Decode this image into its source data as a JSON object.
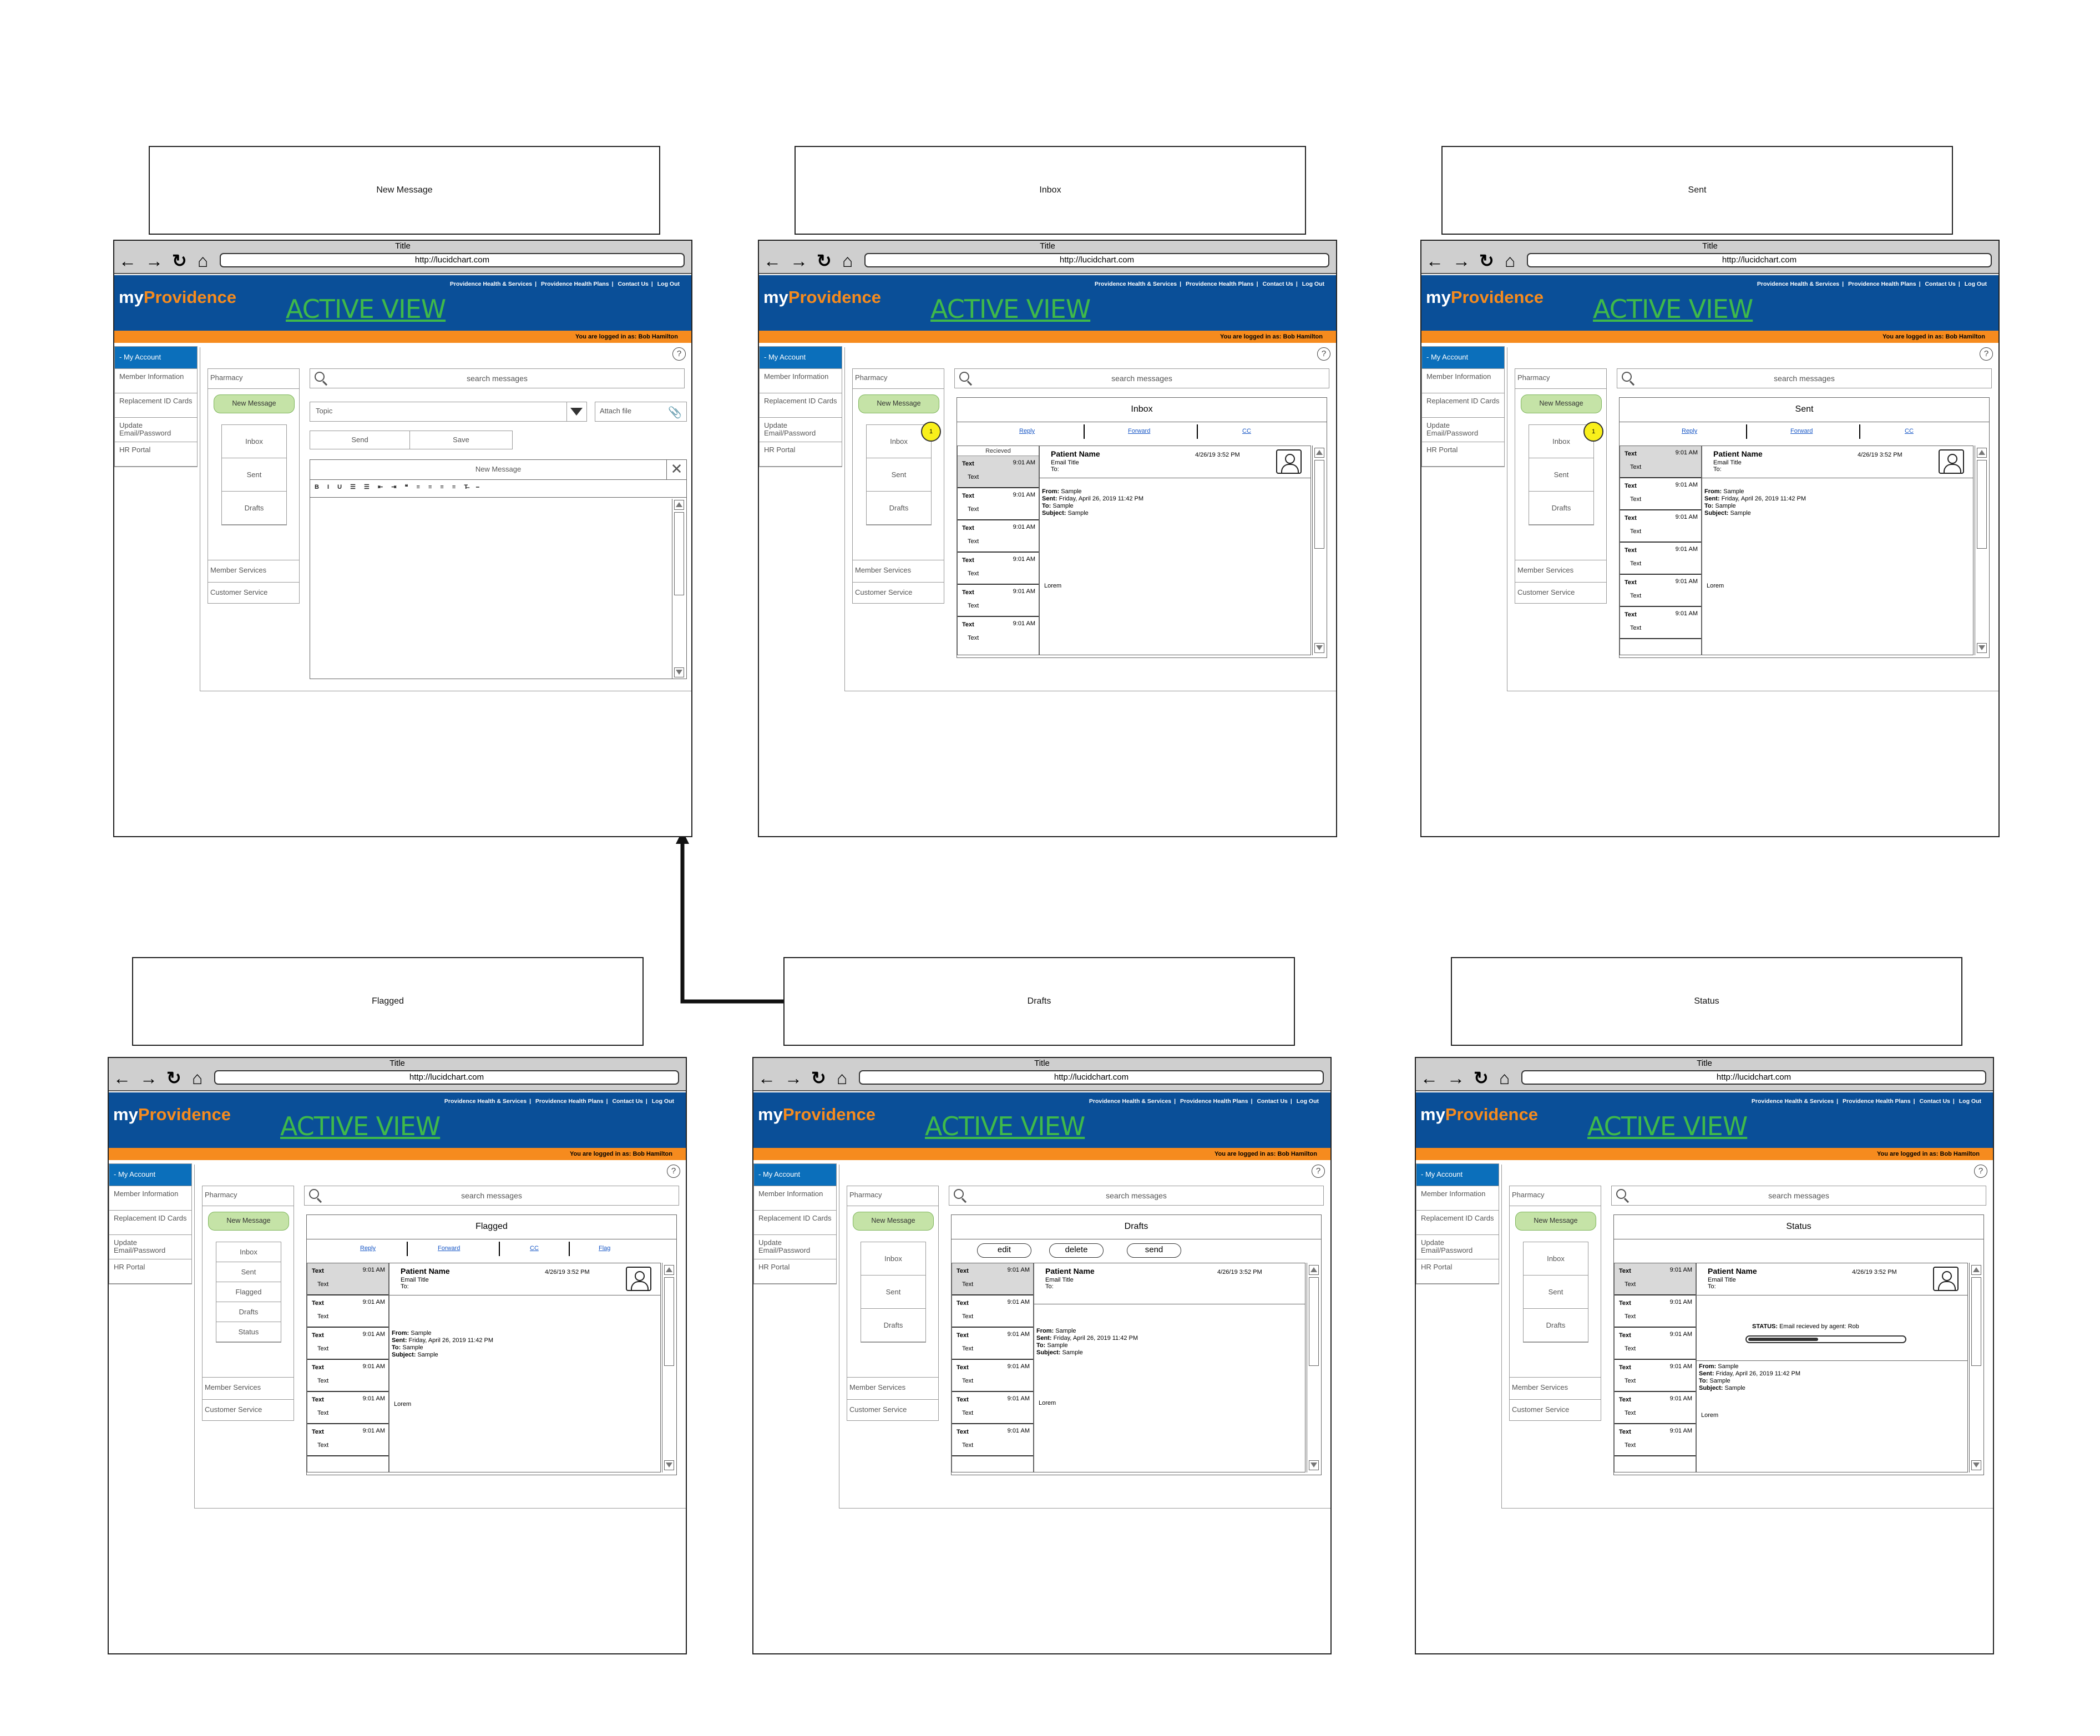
{
  "labels": [
    "New Message",
    "Inbox",
    "Sent",
    "Flagged",
    "Drafts",
    "Status"
  ],
  "browser": {
    "title": "Title",
    "url": "http://lucidchart.com",
    "nav_icons": [
      "back-arrow-icon",
      "forward-arrow-icon",
      "refresh-icon",
      "home-icon"
    ]
  },
  "site": {
    "logo_my": "my",
    "logo_brand": "Providence",
    "active_view": "ACTIVE VIEW",
    "toplinks": [
      "Providence Health & Services",
      "Providence Health Plans",
      "Contact Us",
      "Log Out"
    ],
    "logged_in": "You are logged in as:  Bob Hamilton",
    "help": "?",
    "colors": {
      "header": "#0a4f98",
      "orange": "#f68b1e",
      "active_view": "#3fb94a",
      "nav_active": "#0b6fbb",
      "new_message": "#c5e3a7",
      "badge": "#f9f01b"
    }
  },
  "left_nav": [
    "- My Account",
    "Member Information",
    "Replacement ID Cards",
    "Update Email/Password",
    "HR Portal"
  ],
  "menu": {
    "pharmacy": "Pharmacy",
    "new_message": "New Message",
    "inbox": "Inbox",
    "sent": "Sent",
    "drafts": "Drafts",
    "flagged": "Flagged",
    "status": "Status",
    "member_services": "Member Services",
    "customer_service": "Customer Service",
    "badge": "1"
  },
  "search_placeholder": "search messages",
  "compose": {
    "topic": "Topic",
    "attach": "Attach file",
    "send": "Send",
    "save": "Save",
    "title": "New Message",
    "toolbar": "B I U ☰ ☰ ⇤ ⇥ ❝ ≡ ≡ ≡ ≡ T̶ ⎯"
  },
  "actions": {
    "reply": "Reply",
    "forward": "Forward",
    "cc": "CC",
    "flag": "Flag"
  },
  "drafts_buttons": {
    "edit": "edit",
    "delete": "delete",
    "send": "send"
  },
  "list": {
    "header": "Recieved",
    "row_title": "Text",
    "row_sub": "Text",
    "row_time": "9:01 AM"
  },
  "detail": {
    "patient_name": "Patient Name",
    "email_title": "Email Title",
    "to": "To:",
    "date": "4/26/19 3:52 PM",
    "from_label": "From:",
    "from_value": "Sample",
    "sent_label": "Sent:",
    "sent_value": "Friday, April 26, 2019 11:42 PM",
    "to_label": "To:",
    "to_value": "Sample",
    "subject_label": "Subject:",
    "subject_value": "Sample",
    "lorem": "Lorem"
  },
  "status_screen": {
    "status_label": "STATUS:",
    "status_text": "Email recieved by agent: Rob",
    "progress": 0.45
  }
}
